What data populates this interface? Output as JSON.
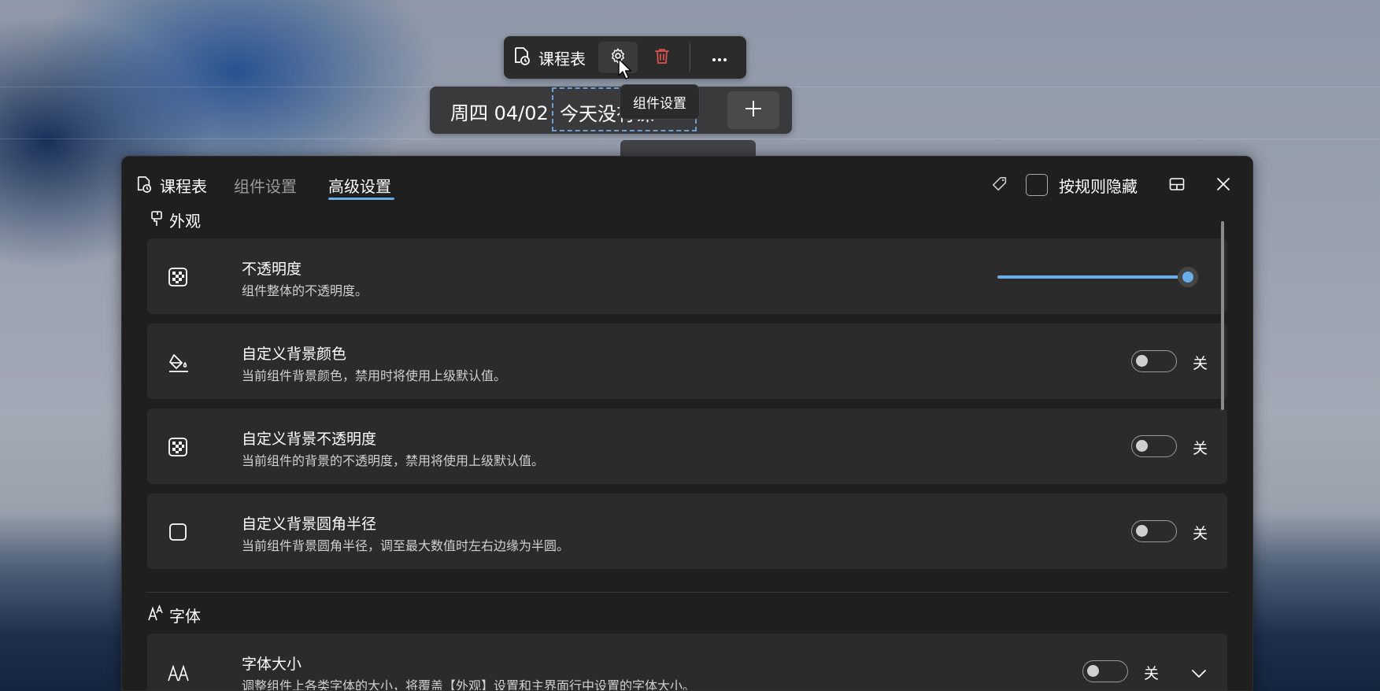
{
  "toolbar": {
    "title": "课程表",
    "tooltip": "组件设置",
    "icons": [
      "schedule-doc-icon",
      "gear-icon",
      "trash-icon",
      "more-icon"
    ]
  },
  "widget": {
    "date": "周四 04/02",
    "text": "今天没有课"
  },
  "panel": {
    "title": "课程表",
    "tabs": [
      {
        "label": "组件设置",
        "active": false
      },
      {
        "label": "高级设置",
        "active": true
      }
    ],
    "hide_by_rule_label": "按规则隐藏",
    "hide_by_rule_checked": false
  },
  "sections": {
    "appearance": {
      "title": "外观",
      "items": [
        {
          "title": "不透明度",
          "desc": "组件整体的不透明度。",
          "slider_value": 1.0
        },
        {
          "title": "自定义背景颜色",
          "desc": "当前组件背景颜色，禁用时将使用上级默认值。",
          "state": "关"
        },
        {
          "title": "自定义背景不透明度",
          "desc": "当前组件的背景的不透明度，禁用将使用上级默认值。",
          "state": "关"
        },
        {
          "title": "自定义背景圆角半径",
          "desc": "当前组件背景圆角半径，调至最大数值时左右边缘为半圆。",
          "state": "关"
        }
      ]
    },
    "font": {
      "title": "字体",
      "items": [
        {
          "title": "字体大小",
          "desc": "调整组件上各类字体的大小，将覆盖【外观】设置和主界面行中设置的字体大小。",
          "state": "关"
        }
      ]
    }
  },
  "colors": {
    "accent": "#6aaee8",
    "delete": "#d9534f",
    "panel_bg": "#1f1f1f",
    "card_bg": "#2b2b2b"
  }
}
